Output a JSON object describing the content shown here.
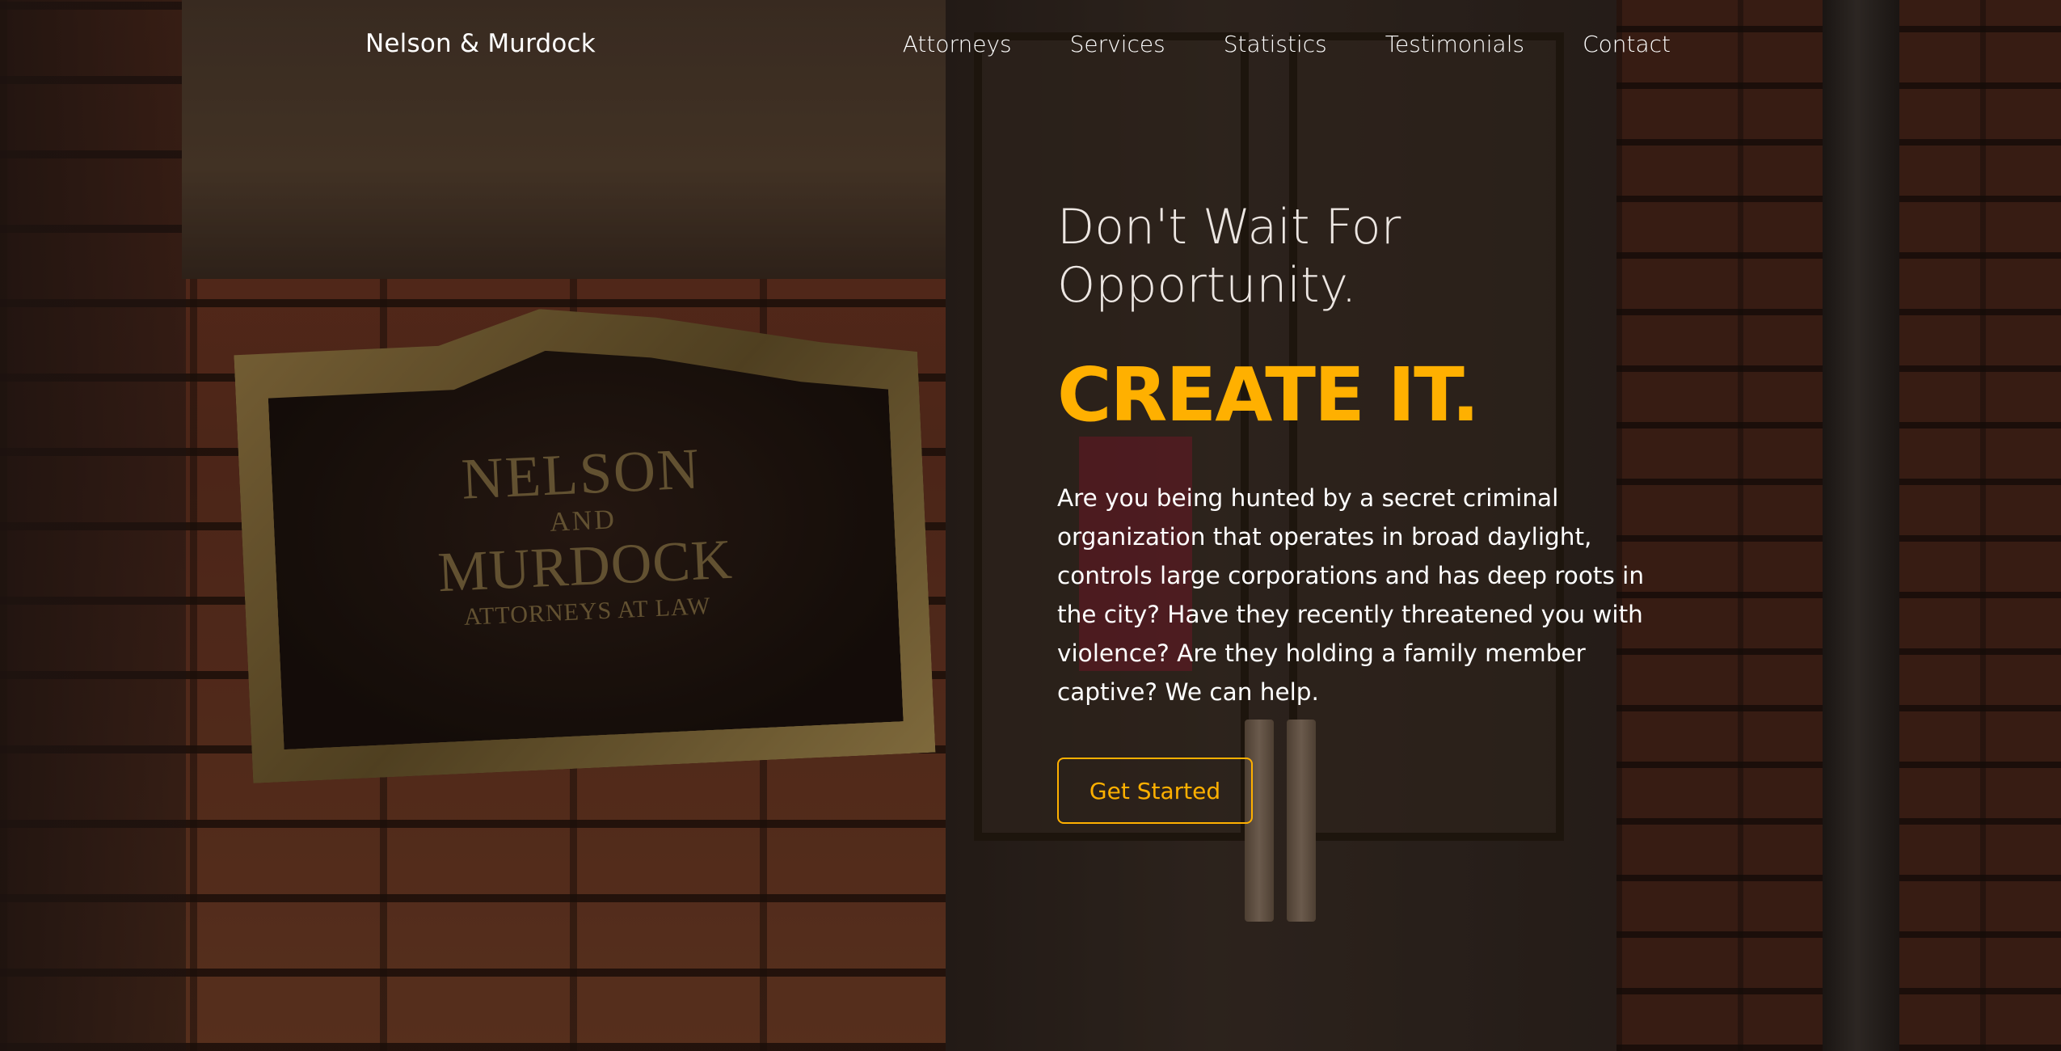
{
  "brand": "Nelson & Murdock",
  "nav": {
    "items": [
      "Attorneys",
      "Services",
      "Statistics",
      "Testimonials",
      "Contact"
    ]
  },
  "plaque": {
    "line1": "NELSON",
    "line2": "AND",
    "line3": "MURDOCK",
    "line4": "ATTORNEYS AT LAW"
  },
  "hero": {
    "heading_line1": "Don't Wait For",
    "heading_line2": "Opportunity.",
    "accent": "CREATE IT.",
    "body": "Are you being hunted by a secret criminal organization that operates in broad daylight, controls large corporations and has deep roots in the city? Have they recently threatened you with violence? Are they holding a family member captive? We can help.",
    "cta_label": "Get Started"
  },
  "colors": {
    "accent": "#ffb000",
    "text": "#ffffff",
    "heading": "#ece6e2"
  }
}
